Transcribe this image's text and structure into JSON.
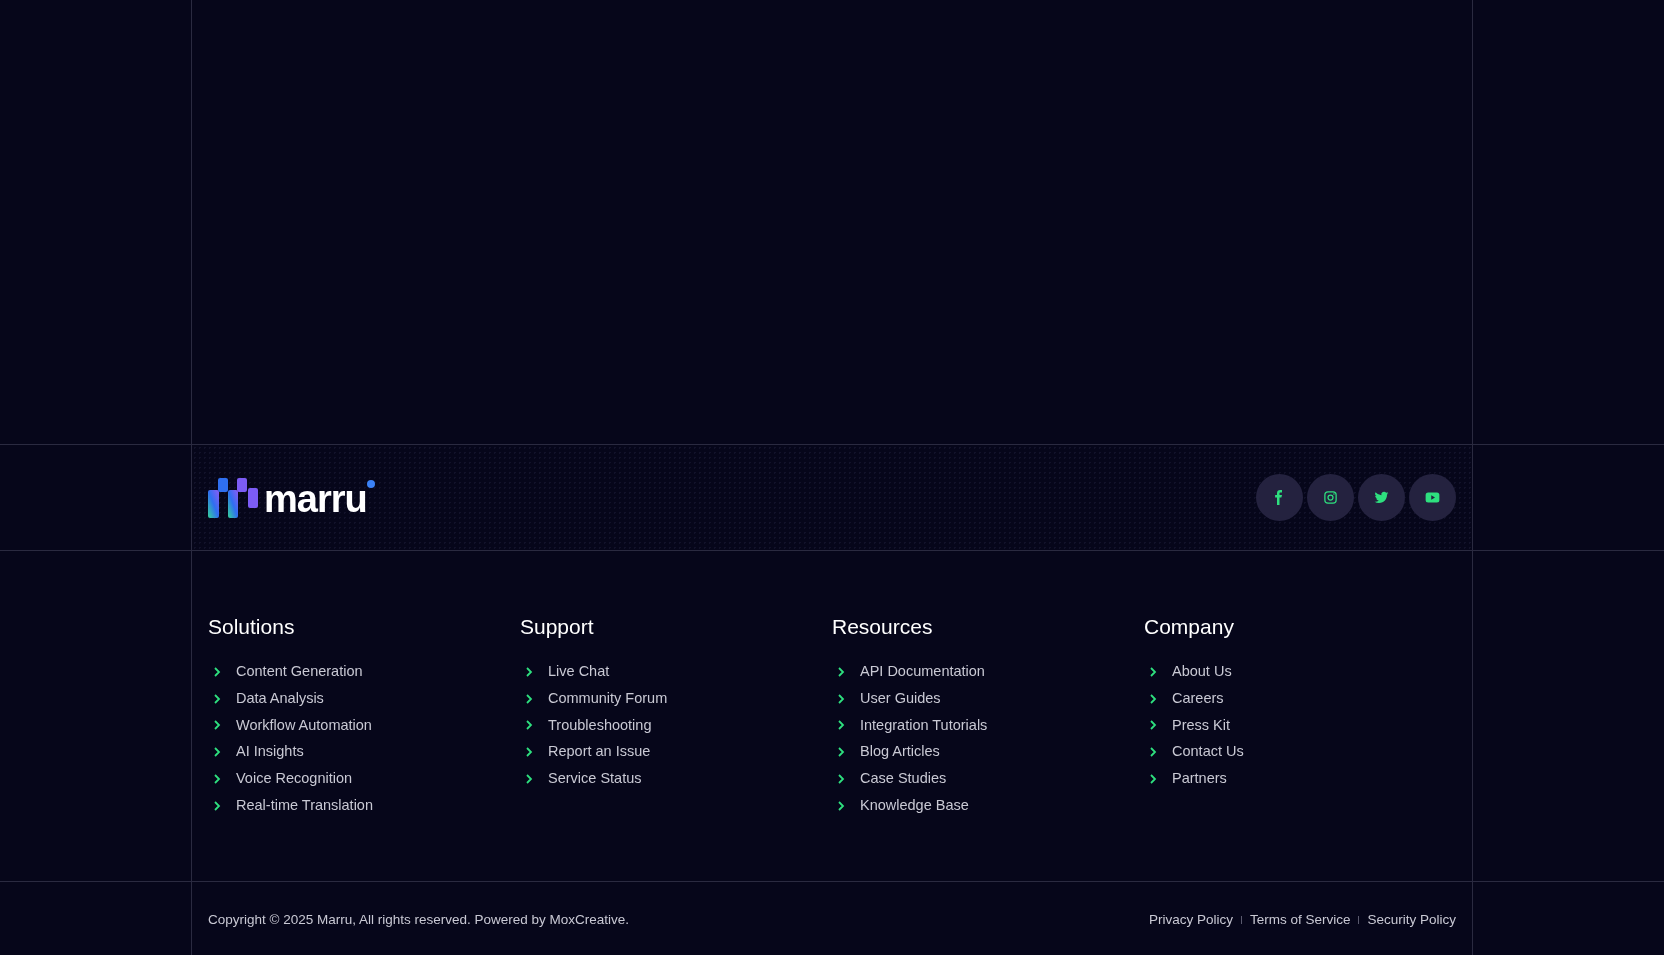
{
  "brand": {
    "name": "marru"
  },
  "social": [
    {
      "kind": "facebook"
    },
    {
      "kind": "instagram"
    },
    {
      "kind": "twitter"
    },
    {
      "kind": "youtube"
    }
  ],
  "columns": [
    {
      "title": "Solutions",
      "links": [
        "Content Generation",
        "Data Analysis",
        "Workflow Automation",
        "AI Insights",
        "Voice Recognition",
        "Real-time Translation"
      ]
    },
    {
      "title": "Support",
      "links": [
        "Live Chat",
        "Community Forum",
        "Troubleshooting",
        "Report an Issue",
        "Service Status"
      ]
    },
    {
      "title": "Resources",
      "links": [
        "API Documentation",
        "User Guides",
        "Integration Tutorials",
        "Blog Articles",
        "Case Studies",
        "Knowledge Base"
      ]
    },
    {
      "title": "Company",
      "links": [
        "About Us",
        "Careers",
        "Press Kit",
        "Contact Us",
        "Partners"
      ]
    }
  ],
  "copyright": "Copyright © 2025 Marru, All rights reserved. Powered by MoxCreative.",
  "legal_links": [
    "Privacy Policy",
    "Terms of Service",
    "Security Policy"
  ]
}
